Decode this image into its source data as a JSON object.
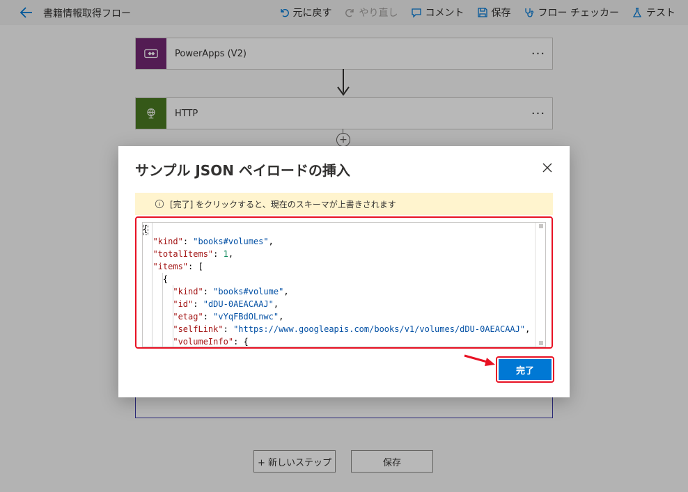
{
  "toolbar": {
    "title": "書籍情報取得フロー",
    "undo": "元に戻す",
    "redo": "やり直し",
    "comment": "コメント",
    "save": "保存",
    "checker": "フロー チェッカー",
    "test": "テスト"
  },
  "steps": [
    {
      "label": "PowerApps (V2)",
      "color": "#742774",
      "more": "···"
    },
    {
      "label": "HTTP",
      "color": "#4a7b22",
      "more": "···"
    }
  ],
  "footer": {
    "new_step": "+ 新しいステップ",
    "save": "保存"
  },
  "dialog": {
    "title": "サンプル JSON ペイロードの挿入",
    "info": "[完了] をクリックすると、現在のスキーマが上書きされます",
    "done": "完了",
    "code": [
      {
        "t": [
          {
            "c": "p",
            "v": "{"
          }
        ]
      },
      {
        "t": [
          {
            "c": "p",
            "v": "  "
          },
          {
            "c": "key",
            "v": "\"kind\""
          },
          {
            "c": "p",
            "v": ": "
          },
          {
            "c": "str",
            "v": "\"books#volumes\""
          },
          {
            "c": "p",
            "v": ","
          }
        ]
      },
      {
        "t": [
          {
            "c": "p",
            "v": "  "
          },
          {
            "c": "key",
            "v": "\"totalItems\""
          },
          {
            "c": "p",
            "v": ": "
          },
          {
            "c": "num",
            "v": "1"
          },
          {
            "c": "p",
            "v": ","
          }
        ]
      },
      {
        "t": [
          {
            "c": "p",
            "v": "  "
          },
          {
            "c": "key",
            "v": "\"items\""
          },
          {
            "c": "p",
            "v": ": ["
          }
        ]
      },
      {
        "t": [
          {
            "c": "p",
            "v": "    {"
          }
        ]
      },
      {
        "t": [
          {
            "c": "p",
            "v": "      "
          },
          {
            "c": "key",
            "v": "\"kind\""
          },
          {
            "c": "p",
            "v": ": "
          },
          {
            "c": "str",
            "v": "\"books#volume\""
          },
          {
            "c": "p",
            "v": ","
          }
        ]
      },
      {
        "t": [
          {
            "c": "p",
            "v": "      "
          },
          {
            "c": "key",
            "v": "\"id\""
          },
          {
            "c": "p",
            "v": ": "
          },
          {
            "c": "str",
            "v": "\"dDU-0AEACAAJ\""
          },
          {
            "c": "p",
            "v": ","
          }
        ]
      },
      {
        "t": [
          {
            "c": "p",
            "v": "      "
          },
          {
            "c": "key",
            "v": "\"etag\""
          },
          {
            "c": "p",
            "v": ": "
          },
          {
            "c": "str",
            "v": "\"vYqFBdOLnwc\""
          },
          {
            "c": "p",
            "v": ","
          }
        ]
      },
      {
        "t": [
          {
            "c": "p",
            "v": "      "
          },
          {
            "c": "key",
            "v": "\"selfLink\""
          },
          {
            "c": "p",
            "v": ": "
          },
          {
            "c": "str",
            "v": "\"https://www.googleapis.com/books/v1/volumes/dDU-0AEACAAJ\""
          },
          {
            "c": "p",
            "v": ","
          }
        ]
      },
      {
        "t": [
          {
            "c": "p",
            "v": "      "
          },
          {
            "c": "key",
            "v": "\"volumeInfo\""
          },
          {
            "c": "p",
            "v": ": {"
          }
        ]
      }
    ]
  }
}
